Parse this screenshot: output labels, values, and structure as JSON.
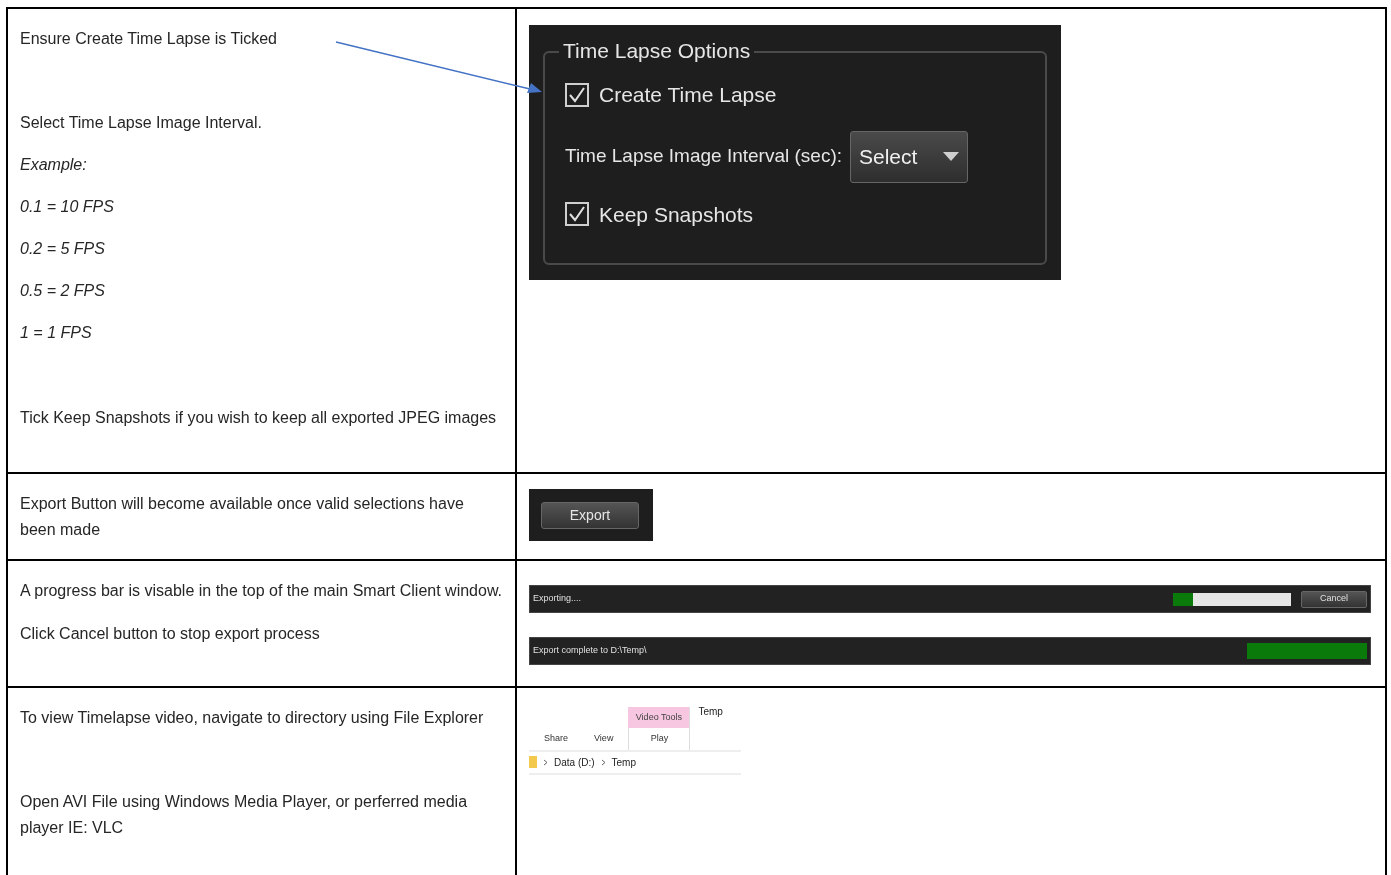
{
  "rows": [
    {
      "notes": [
        {
          "text": "Ensure Create Time Lapse is Ticked",
          "italic": false
        },
        {
          "text": "Select Time Lapse Image Interval.",
          "italic": false
        },
        {
          "text": "Example:",
          "italic": true
        },
        {
          "text": "0.1 = 10 FPS",
          "italic": true
        },
        {
          "text": "0.2 = 5 FPS",
          "italic": true
        },
        {
          "text": "0.5 = 2 FPS",
          "italic": true
        },
        {
          "text": "1 = 1 FPS",
          "italic": true
        },
        {
          "text": "Tick Keep Snapshots if you wish to keep all exported JPEG images",
          "italic": false
        }
      ],
      "options": {
        "title": "Time Lapse Options",
        "create": {
          "label": "Create Time Lapse",
          "checked": true
        },
        "interval": {
          "label": "Time Lapse Image Interval (sec):",
          "value": "Select"
        },
        "keep": {
          "label": "Keep Snapshots",
          "checked": true
        }
      }
    },
    {
      "notes": [
        {
          "text": "Export Button will become available once valid selections have been made",
          "italic": false
        }
      ],
      "export_button": "Export"
    },
    {
      "notes": [
        {
          "text": "A progress bar is visable in the top of the main Smart Client window.",
          "italic": false
        },
        {
          "text": "Click Cancel button to stop export process",
          "italic": false
        }
      ],
      "progress": [
        {
          "status": "Exporting....",
          "level": 0.17,
          "cancel": "Cancel"
        },
        {
          "status": "Export complete to D:\\Temp\\",
          "level": 1
        }
      ]
    },
    {
      "notes": [
        {
          "text": "To view Timelapse video, navigate to directory using File Explorer",
          "italic": false
        },
        {
          "text": "Open AVI File using Windows Media Player, or perferred media player IE: VLC",
          "italic": false
        }
      ],
      "explorer": {
        "context_tab": "Video Tools",
        "title": "Temp",
        "tabs": [
          "Share",
          "View"
        ],
        "context_sub_tab": "Play",
        "path": [
          "Data (D:)",
          "Temp"
        ]
      }
    }
  ]
}
